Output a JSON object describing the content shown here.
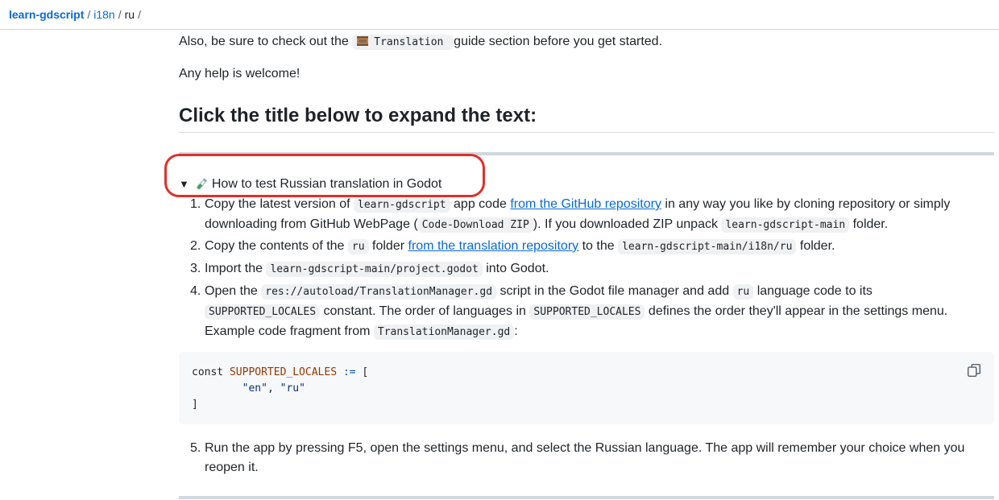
{
  "breadcrumb": {
    "repo": "learn-gdscript",
    "folder": "i18n",
    "current": "ru",
    "sep1": "/",
    "sep2": "/",
    "sep3": "/"
  },
  "intro": {
    "also_before": "Also, be sure to check out the",
    "translation_code": "Translation",
    "also_after": "guide section before you get started.",
    "help": "Any help is welcome!"
  },
  "heading": "Click the title below to expand the text:",
  "details": {
    "summary": "How to test Russian translation in Godot",
    "steps": [
      {
        "num": "1.",
        "a": "Copy the latest version of",
        "code1": "learn-gdscript",
        "b": "app code",
        "link": "from the GitHub repository",
        "c": "in any way you like by cloning repository or simply downloading from GitHub WebPage (",
        "code2": "Code-Download ZIP",
        "d": "). If you downloaded ZIP unpack",
        "code3": "learn-gdscript-main",
        "e": "folder."
      },
      {
        "num": "2.",
        "a": "Copy the contents of the",
        "code1": "ru",
        "b": "folder",
        "link": "from the translation repository",
        "c": "to the",
        "code2": "learn-gdscript-main/i18n/ru",
        "d": "folder."
      },
      {
        "num": "3.",
        "a": "Import the",
        "code1": "learn-gdscript-main/project.godot",
        "b": "into Godot."
      },
      {
        "num": "4.",
        "a": "Open the",
        "code1": "res://autoload/TranslationManager.gd",
        "b": "script in the Godot file manager and add",
        "code2": "ru",
        "c": "language code to its",
        "code3": "SUPPORTED_LOCALES",
        "d": "constant. The order of languages in",
        "code4": "SUPPORTED_LOCALES",
        "e": "defines the order they'll appear in the settings menu. Example code fragment from",
        "code5": "TranslationManager.gd",
        "f": ":"
      },
      {
        "num": "5.",
        "a": "Run the app by pressing F5, open the settings menu, and select the Russian language. The app will remember your choice when you reopen it."
      }
    ],
    "code": {
      "kw": "const",
      "var": "SUPPORTED_LOCALES",
      "op": ":=",
      "open": "[",
      "indent": "        ",
      "s1": "\"en\"",
      "comma": ", ",
      "s2": "\"ru\"",
      "close": "]"
    }
  },
  "colors": {
    "link": "#0969da",
    "annotation": "#e0302a",
    "code_bg": "#f6f8fa"
  },
  "icons": {
    "translation": "scroll-icon",
    "summary": "test-tube-icon",
    "copy": "copy-icon"
  }
}
